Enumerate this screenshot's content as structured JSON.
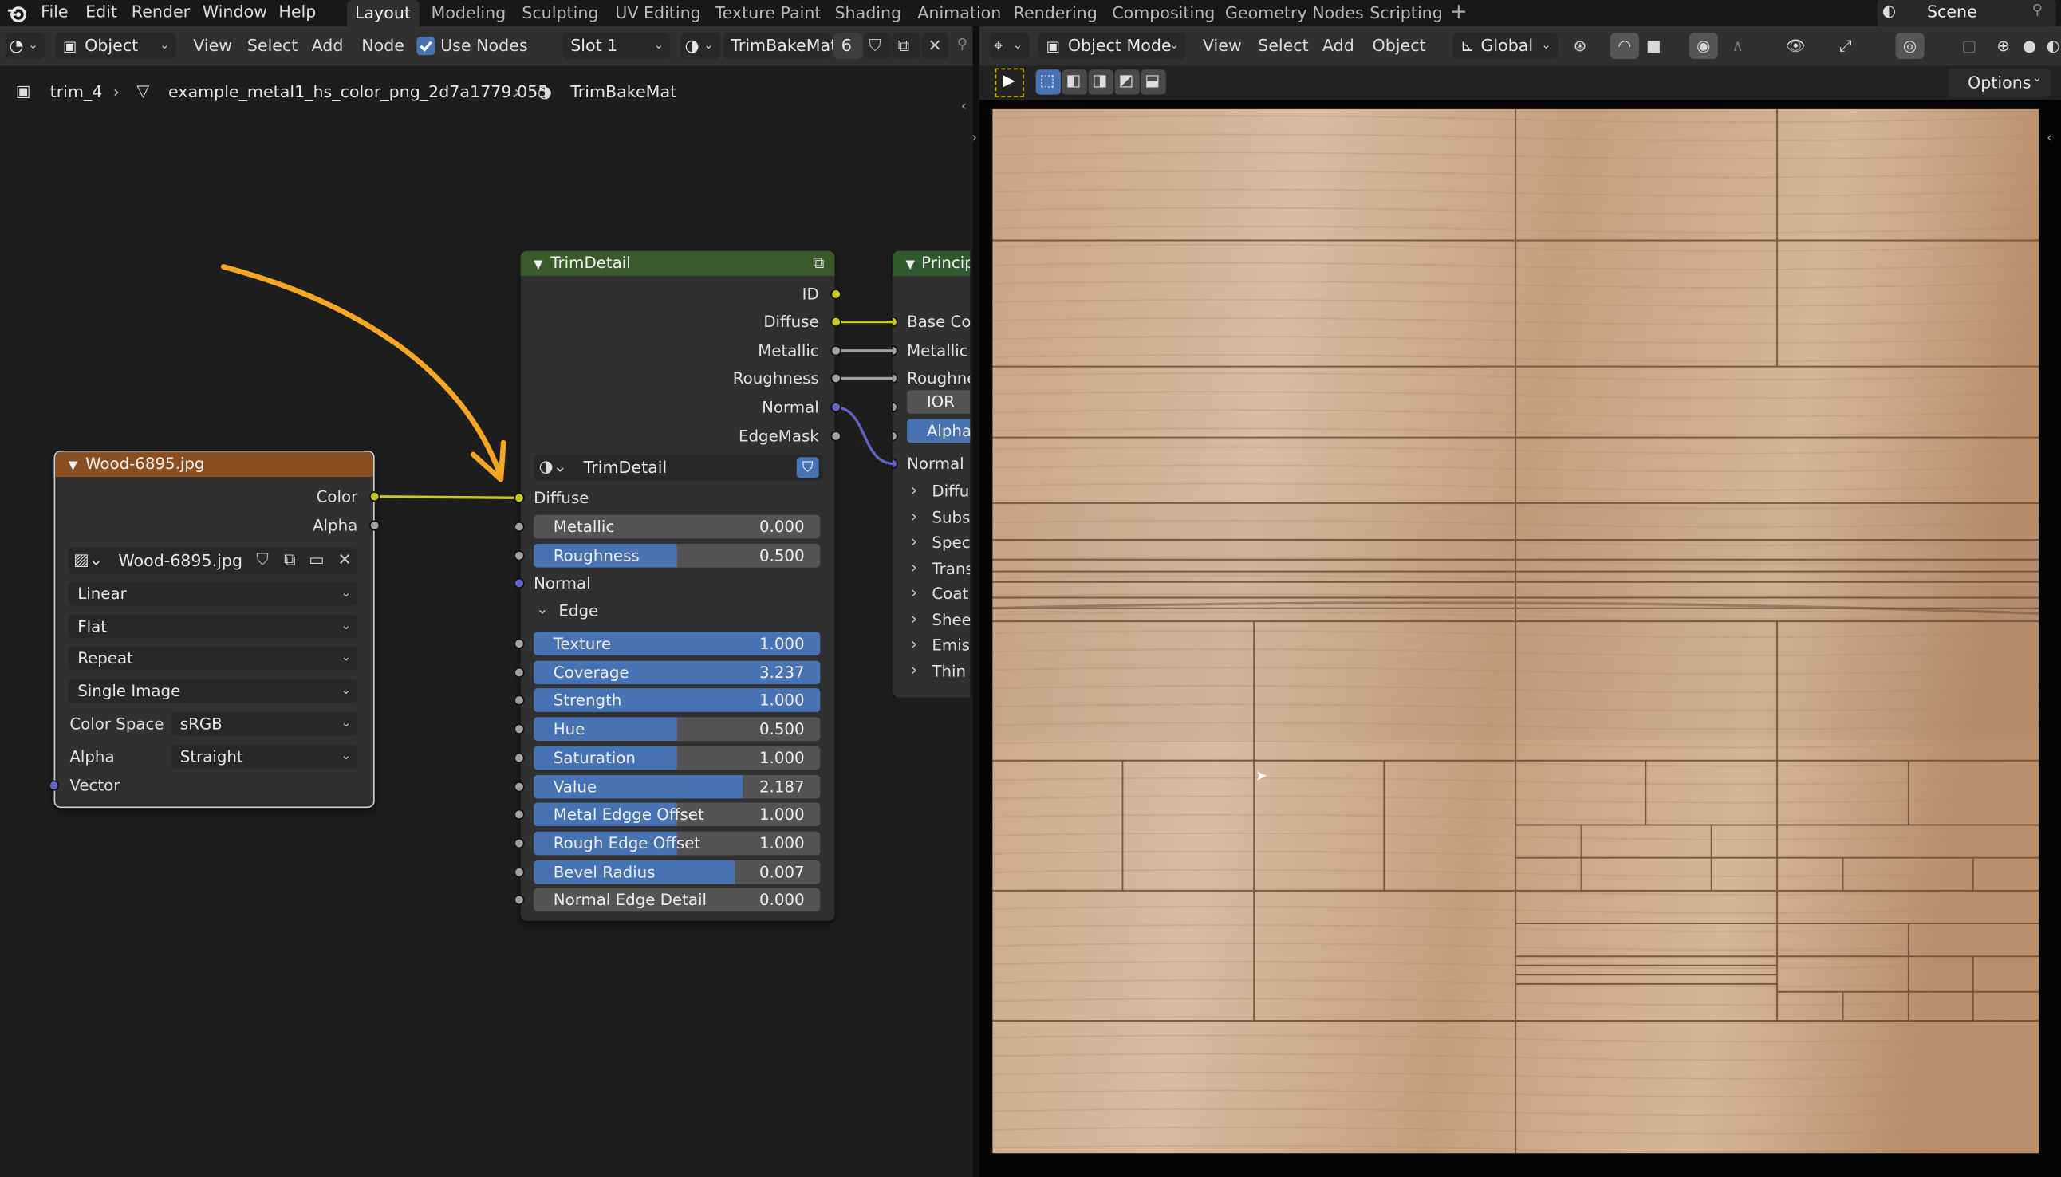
{
  "colors": {
    "accent": "#4772b3",
    "socket_color": "#c7c729",
    "socket_gray": "#a1a1a1",
    "socket_vector": "#6363c7",
    "header_image": "#8a4f20",
    "header_group": "#3a5a2a",
    "header_shader": "#2e5a2e",
    "arrow": "#f5a623"
  },
  "topbar": {
    "menus": [
      "File",
      "Edit",
      "Render",
      "Window",
      "Help"
    ],
    "workspaces": [
      "Layout",
      "Modeling",
      "Sculpting",
      "UV Editing",
      "Texture Paint",
      "Shading",
      "Animation",
      "Rendering",
      "Compositing",
      "Geometry Nodes",
      "Scripting"
    ],
    "active_workspace": "Layout",
    "add_tab_icon": "plus-icon",
    "scene_label": "Scene"
  },
  "node_editor": {
    "header": {
      "mode": "Object",
      "menus": [
        "View",
        "Select",
        "Add",
        "Node"
      ],
      "use_nodes_label": "Use Nodes",
      "use_nodes_checked": true,
      "slot": "Slot 1",
      "material": "TrimBakeMat",
      "user_count": "6"
    },
    "breadcrumb": {
      "object": "trim_4",
      "mesh": "example_metal1_hs_color_png_2d7a1779.055",
      "material": "TrimBakeMat"
    },
    "image_node": {
      "title": "Wood-6895.jpg",
      "outputs": [
        "Color",
        "Alpha"
      ],
      "image_name": "Wood-6895.jpg",
      "interpolation": "Linear",
      "projection": "Flat",
      "extension": "Repeat",
      "source": "Single Image",
      "color_space_label": "Color Space",
      "color_space": "sRGB",
      "alpha_label": "Alpha",
      "alpha_mode": "Straight",
      "vector_label": "Vector"
    },
    "group_node": {
      "title": "TrimDetail",
      "outputs": [
        "ID",
        "Diffuse",
        "Metallic",
        "Roughness",
        "Normal",
        "EdgeMask"
      ],
      "group_name": "TrimDetail",
      "diffuse_label": "Diffuse",
      "normal_label": "Normal",
      "edge_label": "Edge",
      "params_top": [
        {
          "label": "Metallic",
          "value": "0.000",
          "fill": 0.0
        },
        {
          "label": "Roughness",
          "value": "0.500",
          "fill": 0.5
        }
      ],
      "params_edge": [
        {
          "label": "Texture",
          "value": "1.000",
          "fill": 1.0
        },
        {
          "label": "Coverage",
          "value": "3.237",
          "fill": 1.0
        },
        {
          "label": "Strength",
          "value": "1.000",
          "fill": 1.0
        },
        {
          "label": "Hue",
          "value": "0.500",
          "fill": 0.5
        },
        {
          "label": "Saturation",
          "value": "1.000",
          "fill": 0.5
        },
        {
          "label": "Value",
          "value": "2.187",
          "fill": 0.73
        },
        {
          "label": "Metal Edgge Offset",
          "value": "1.000",
          "fill": 0.5
        },
        {
          "label": "Rough Edge Offset",
          "value": "1.000",
          "fill": 0.5
        },
        {
          "label": "Bevel Radius",
          "value": "0.007",
          "fill": 0.7
        },
        {
          "label": "Normal Edge Detail",
          "value": "0.000",
          "fill": 0.0
        }
      ]
    },
    "principled_node": {
      "title": "Princip",
      "inputs": [
        "Base Colo",
        "Metallic",
        "Roughness"
      ],
      "ior_label": "IOR",
      "alpha_label": "Alpha",
      "normal_label": "Normal",
      "panels": [
        "Diffus",
        "Subsu",
        "Specu",
        "Trans",
        "Coat",
        "Sheer",
        "Emiss",
        "Thin F"
      ]
    }
  },
  "viewport": {
    "header": {
      "mode": "Object Mode",
      "menus": [
        "View",
        "Select",
        "Add",
        "Object"
      ],
      "transform_orientation": "Global"
    },
    "options_label": "Options"
  }
}
